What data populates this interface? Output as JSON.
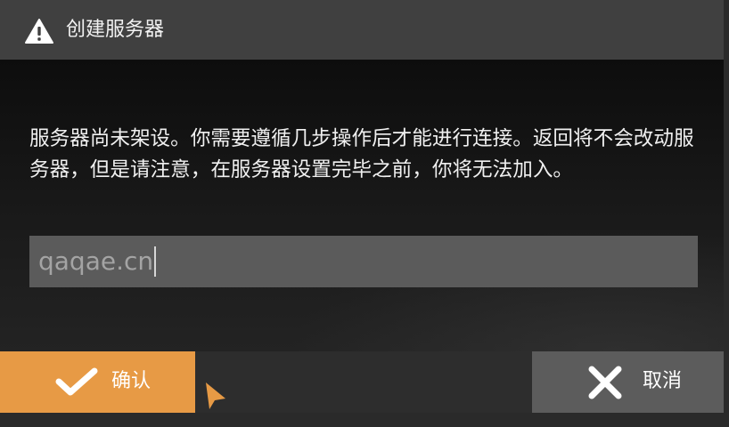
{
  "dialog": {
    "title": "创建服务器",
    "title_icon": "warning-icon",
    "message": "服务器尚未架设。你需要遵循几步操作后才能进行连接。返回将不会改动服务器，但是请注意，在服务器设置完毕之前，你将无法加入。",
    "input": {
      "value": "qaqae.cn"
    },
    "buttons": {
      "confirm_label": "确认",
      "confirm_icon": "checkmark-icon",
      "cancel_label": "取消",
      "cancel_icon": "close-icon"
    }
  },
  "colors": {
    "title_bar": "#404040",
    "confirm": "#e79a45",
    "cancel": "#5c5c5c",
    "input_background": "#5b5b5b",
    "cursor": "#e79a45"
  }
}
